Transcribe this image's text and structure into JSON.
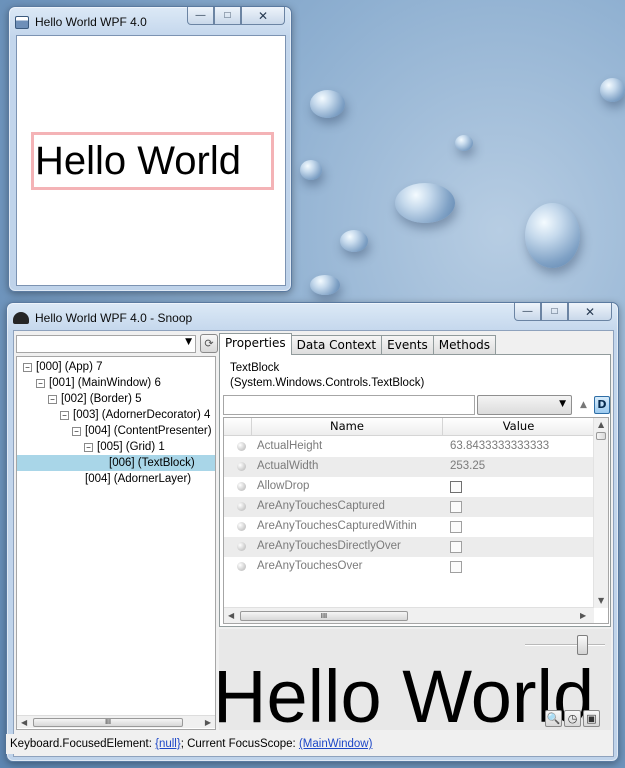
{
  "hello_window": {
    "title": "Hello World WPF 4.0",
    "text": "Hello World",
    "buttons": {
      "minimize": "—",
      "maximize": "□",
      "close": "✕"
    }
  },
  "snoop_window": {
    "title": "Hello World WPF 4.0 - Snoop",
    "buttons": {
      "minimize": "—",
      "maximize": "□",
      "close": "✕"
    },
    "window_combo": {
      "value": "",
      "arrow": "▼"
    },
    "refresh_icon": "⟳",
    "tree": [
      {
        "label": "[000]  (App) 7",
        "expander": "−"
      },
      {
        "label": "[001]  (MainWindow) 6",
        "expander": "−"
      },
      {
        "label": "[002]  (Border) 5",
        "expander": "−"
      },
      {
        "label": "[003]  (AdornerDecorator) 4",
        "expander": "−"
      },
      {
        "label": "[004]  (ContentPresenter) 2",
        "expander": "−"
      },
      {
        "label": "[005]  (Grid) 1",
        "expander": "−"
      },
      {
        "label": "[006]  (TextBlock)",
        "expander": "",
        "selected": true
      },
      {
        "label": "[004]  (AdornerLayer)",
        "expander": ""
      }
    ],
    "tabs": [
      "Properties",
      "Data Context",
      "Events",
      "Methods"
    ],
    "selected_type": {
      "name": "TextBlock",
      "full": "(System.Windows.Controls.TextBlock)"
    },
    "filter": {
      "value": "",
      "combo_value": "",
      "arrow": "▼",
      "sort_icon": "▲",
      "d_button": "D"
    },
    "grid": {
      "headers": {
        "name": "Name",
        "value": "Value"
      },
      "rows": [
        {
          "name": "ActualHeight",
          "value": "63.8433333333333",
          "type": "text"
        },
        {
          "name": "ActualWidth",
          "value": "253.25",
          "type": "text"
        },
        {
          "name": "AllowDrop",
          "value": "",
          "type": "check"
        },
        {
          "name": "AreAnyTouchesCaptured",
          "value": "",
          "type": "check"
        },
        {
          "name": "AreAnyTouchesCapturedWithin",
          "value": "",
          "type": "check"
        },
        {
          "name": "AreAnyTouchesDirectlyOver",
          "value": "",
          "type": "check"
        },
        {
          "name": "AreAnyTouchesOver",
          "value": "",
          "type": "check"
        }
      ],
      "scroll_up": "▲",
      "scroll_down": "▼",
      "scroll_left": "◀",
      "scroll_right": "▶",
      "thumb_grip": "III"
    },
    "tree_scroll": {
      "left": "◀",
      "right": "▶",
      "thumb_grip": "III"
    },
    "preview": {
      "text": "Hello World",
      "zoom_level": 0.75
    },
    "preview_tools": {
      "magnifier": "🔍",
      "clock": "◷",
      "camera": "▣"
    },
    "status": {
      "prefix": "Keyboard.FocusedElement: ",
      "focused_link": "{null}",
      "middle": "; Current FocusScope: ",
      "scope_link": "(MainWindow)"
    }
  }
}
